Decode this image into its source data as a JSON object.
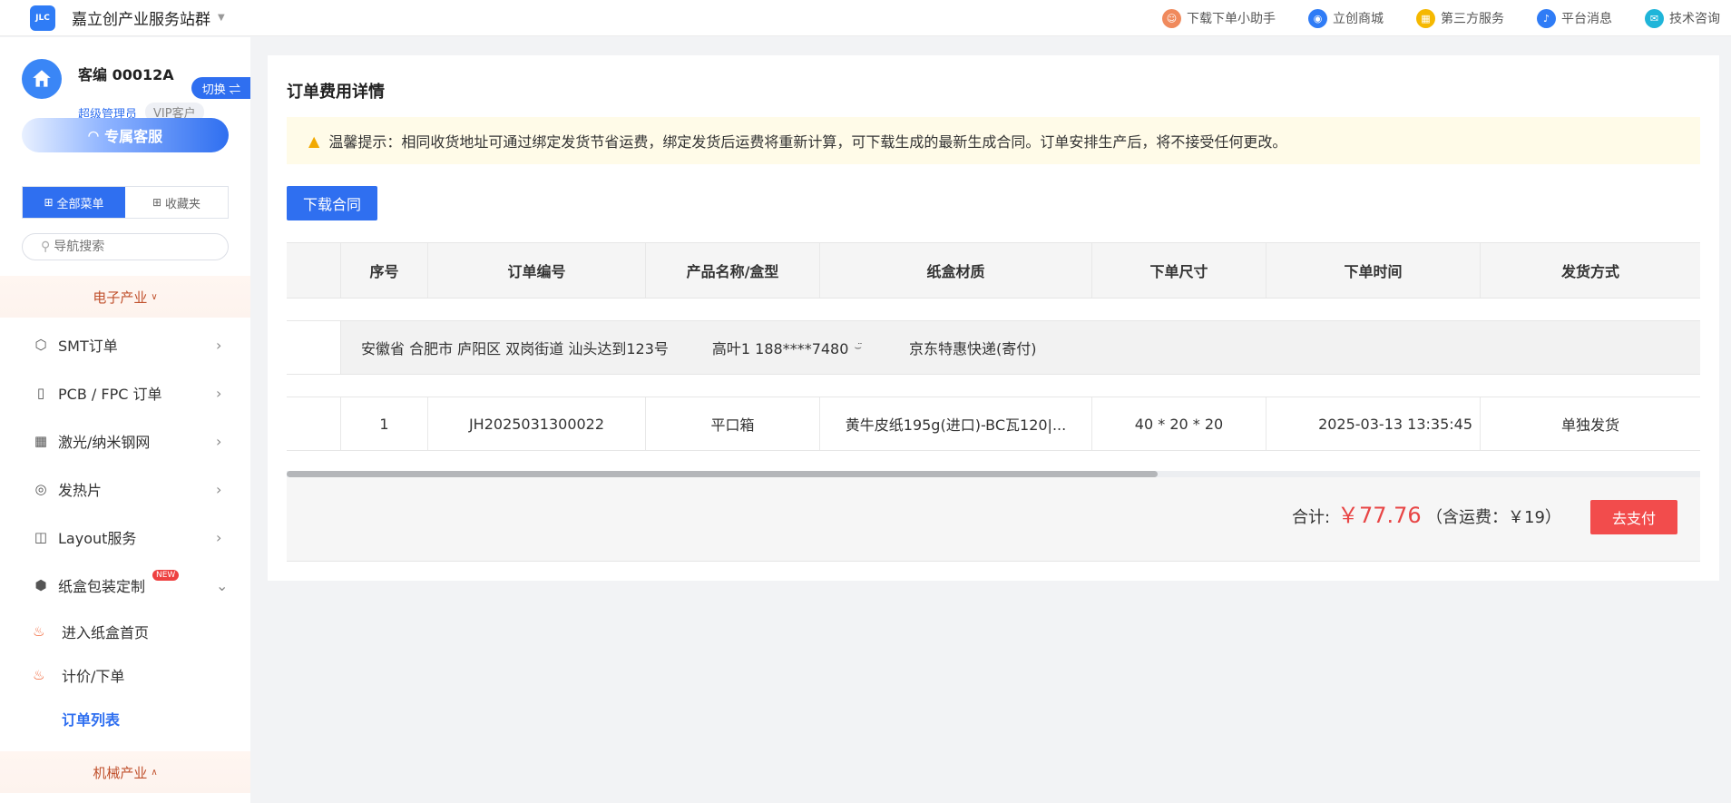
{
  "brand": {
    "logo_text": "JLC",
    "title": "嘉立创产业服务站群"
  },
  "topnav": [
    {
      "label": "下载下单小助手",
      "icon": "assistant-avatar-icon",
      "color": "#f08a5d"
    },
    {
      "label": "立创商城",
      "icon": "mall-icon",
      "color": "#2f7cf6"
    },
    {
      "label": "第三方服务",
      "icon": "apps-icon",
      "color": "#f5b800"
    },
    {
      "label": "平台消息",
      "icon": "bell-icon",
      "color": "#2f7cf6"
    },
    {
      "label": "技术咨询",
      "icon": "chat-icon",
      "color": "#1fb5d9"
    }
  ],
  "user": {
    "name": "客编 00012A",
    "switch_label": "切换 ⇌",
    "role": "超级管理员",
    "vip": "VIP客户"
  },
  "service_button": "专属客服",
  "menu_tabs": {
    "all": "全部菜单",
    "favorites": "收藏夹"
  },
  "search": {
    "placeholder": "导航搜索"
  },
  "sections": {
    "electronics": "电子产业",
    "machinery": "机械产业"
  },
  "nav": {
    "smt": "SMT订单",
    "pcb": "PCB / FPC 订单",
    "stencil": "激光/纳米钢网",
    "heater": "发热片",
    "layout": "Layout服务",
    "carton": "纸盒包装定制",
    "new_badge": "NEW",
    "sub": {
      "home": "进入纸盒首页",
      "quote": "计价/下单",
      "orders": "订单列表"
    }
  },
  "card": {
    "title": "订单费用详情",
    "notice": "温馨提示：相同收货地址可通过绑定发货节省运费，绑定发货后运费将重新计算，可下载生成的最新生成合同。订单安排生产后，将不接受任何更改。",
    "download_contract": "下载合同"
  },
  "table": {
    "headers": [
      "",
      "序号",
      "订单编号",
      "产品名称/盒型",
      "纸盒材质",
      "下单尺寸",
      "下单时间",
      "发货方式"
    ],
    "address": {
      "addr": "安徽省 合肥市 庐阳区 双岗街道 汕头达到123号",
      "contact": "高叶1 188****7480",
      "eye": "⌣̈",
      "shipping": "京东特惠快递(寄付)"
    },
    "rows": [
      [
        "",
        "1",
        "JH2025031300022",
        "平口箱",
        "黄牛皮纸195g(进口)-BC瓦120|...",
        "40 * 20 * 20",
        "2025-03-13 13:35:45",
        "单独发货"
      ]
    ]
  },
  "summary": {
    "total_label": "合计:",
    "amount": "￥77.76",
    "freight": "（含运费：￥19）",
    "pay": "去支付"
  },
  "colors": {
    "accent": "#2f6ff0",
    "danger": "#f24c4c",
    "price": "#e84545",
    "notice_bg": "#fffbe8"
  }
}
